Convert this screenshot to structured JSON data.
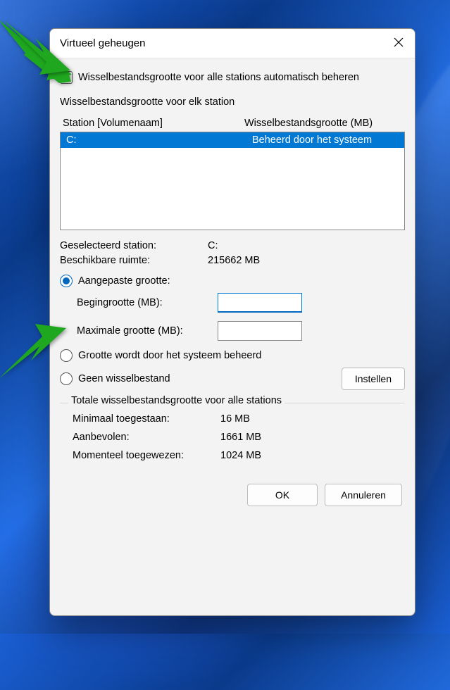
{
  "dialog": {
    "title": "Virtueel geheugen",
    "autoManage": {
      "label": "Wisselbestandsgrootte voor alle stations automatisch beheren",
      "checked": false
    },
    "perDrive": {
      "groupTitle": "Wisselbestandsgrootte voor elk station",
      "headers": {
        "drive": "Station [Volumenaam]",
        "size": "Wisselbestandsgrootte (MB)"
      },
      "rows": [
        {
          "drive": "C:",
          "size": "Beheerd door het systeem"
        }
      ],
      "selectedDrive": {
        "label": "Geselecteerd station:",
        "value": "C:"
      },
      "available": {
        "label": "Beschikbare ruimte:",
        "value": "215662 MB"
      },
      "radios": {
        "custom": "Aangepaste grootte:",
        "system": "Grootte wordt door het systeem beheerd",
        "none": "Geen wisselbestand",
        "selected": "custom"
      },
      "initial": {
        "label": "Begingrootte (MB):",
        "value": ""
      },
      "maximum": {
        "label": "Maximale grootte (MB):",
        "value": ""
      },
      "setButton": "Instellen"
    },
    "totals": {
      "groupTitle": "Totale wisselbestandsgrootte voor alle stations",
      "minAllowed": {
        "label": "Minimaal toegestaan:",
        "value": "16 MB"
      },
      "recommended": {
        "label": "Aanbevolen:",
        "value": "1661 MB"
      },
      "current": {
        "label": "Momenteel toegewezen:",
        "value": "1024 MB"
      }
    },
    "actions": {
      "ok": "OK",
      "cancel": "Annuleren"
    }
  }
}
